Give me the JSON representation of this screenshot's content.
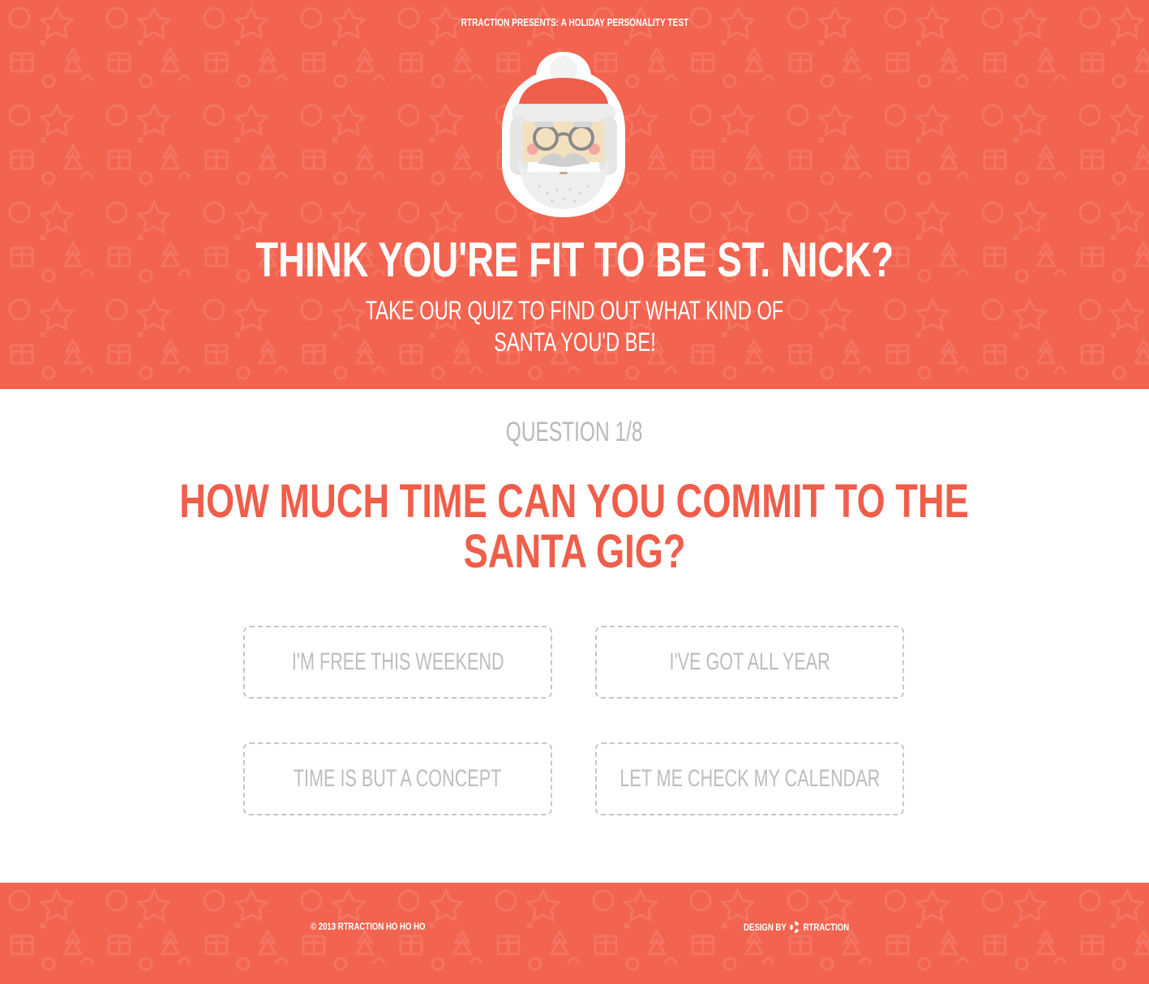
{
  "colors": {
    "brand_red": "#f26450",
    "question_red": "#ef5e4a",
    "muted_gray": "#b9b9b9",
    "white": "#ffffff"
  },
  "hero": {
    "presents": "RTRACTION PRESENTS: A HOLIDAY PERSONALITY TEST",
    "mascot_icon": "santa-face-icon",
    "headline": "THINK YOU'RE FIT TO BE ST. NICK?",
    "subhead_line1": "TAKE OUR QUIZ TO FIND OUT WHAT KIND OF",
    "subhead_line2": "SANTA YOU'D BE!"
  },
  "quiz": {
    "counter": "QUESTION 1/8",
    "question_line1": "HOW MUCH TIME CAN YOU COMMIT TO THE",
    "question_line2": "SANTA GIG?",
    "answers": [
      {
        "label": "I'M FREE THIS WEEKEND"
      },
      {
        "label": "I'VE GOT ALL YEAR"
      },
      {
        "label": "TIME IS BUT A CONCEPT"
      },
      {
        "label": "LET ME CHECK MY CALENDAR"
      }
    ]
  },
  "footer": {
    "copyright": "© 2013 RTRACTION HO HO HO",
    "design_by": "DESIGN BY",
    "brand_icon": "rtraction-logo-icon",
    "brand": "RTRACTION"
  }
}
